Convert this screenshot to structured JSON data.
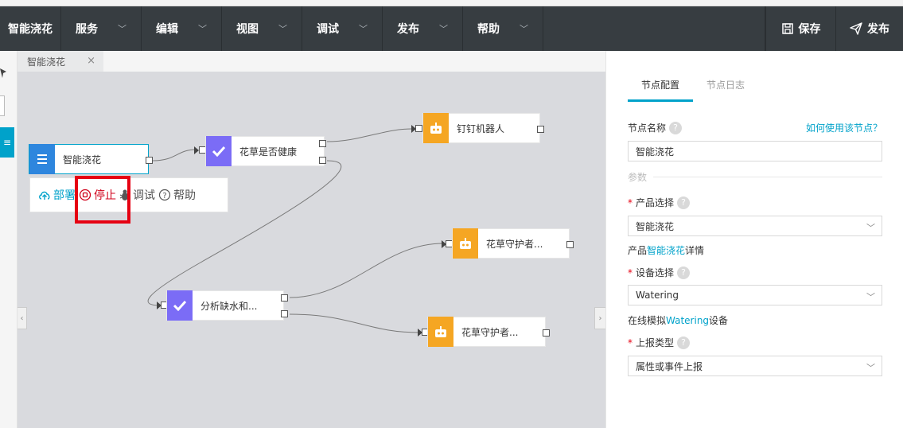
{
  "app": {
    "title": "智能浇花"
  },
  "menu": [
    {
      "label": "服务"
    },
    {
      "label": "编辑"
    },
    {
      "label": "视图"
    },
    {
      "label": "调试"
    },
    {
      "label": "发布"
    },
    {
      "label": "帮助"
    }
  ],
  "actions": {
    "save": "保存",
    "publish": "发布"
  },
  "tab": {
    "label": "智能浇花",
    "close": "×"
  },
  "nodes": {
    "trigger": "智能浇花",
    "condition1": "花草是否健康",
    "robot": "钉钉机器人",
    "guard1": "花草守护者...",
    "analyze": "分析缺水和...",
    "guard2": "花草守护者..."
  },
  "toolbar": {
    "deploy": "部署",
    "stop": "停止",
    "debug": "调试",
    "help": "帮助"
  },
  "panel": {
    "tabs": [
      "节点配置",
      "节点日志"
    ],
    "node_name_label": "节点名称",
    "help_link": "如何使用该节点？",
    "node_name_value": "智能浇花",
    "params_label": "参数",
    "product_label": "产品选择",
    "product_value": "智能浇花",
    "product_detail_prefix": "产品",
    "product_detail_link": "智能浇花",
    "product_detail_suffix": "详情",
    "device_label": "设备选择",
    "device_value": "Watering",
    "sim_prefix": "在线模拟",
    "sim_link": "Watering",
    "sim_suffix": "设备",
    "report_label": "上报类型",
    "report_value": "属性或事件上报"
  },
  "colors": {
    "accent": "#00a2ca",
    "menubar": "#373d41",
    "robot": "#f5a623",
    "check": "#7b6cf6",
    "stop": "#d0021b",
    "highlight": "#e60012"
  }
}
